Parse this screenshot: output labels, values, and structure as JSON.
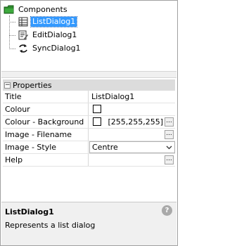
{
  "tree": {
    "root": {
      "label": "Components",
      "expanded": true
    },
    "children": [
      {
        "label": "ListDialog1",
        "icon": "list-dialog-icon",
        "selected": true
      },
      {
        "label": "EditDialog1",
        "icon": "edit-dialog-icon",
        "selected": false
      },
      {
        "label": "SyncDialog1",
        "icon": "sync-dialog-icon",
        "selected": false
      }
    ]
  },
  "properties": {
    "category": "Properties",
    "rows": [
      {
        "name": "Title",
        "value": "ListDialog1"
      },
      {
        "name": "Colour",
        "value": ""
      },
      {
        "name": "Colour - Background",
        "value": "[255,255,255]"
      },
      {
        "name": "Image - Filename",
        "value": ""
      },
      {
        "name": "Image - Style",
        "value": "Centre"
      },
      {
        "name": "Help",
        "value": ""
      }
    ],
    "ellipsis_label": "..."
  },
  "help": {
    "title": "ListDialog1",
    "description": "Represents a list dialog",
    "help_glyph": "?"
  },
  "colors": {
    "selection": "#3399ff",
    "category_bg": "#dcdcdc",
    "panel_bg": "#f0f0f0"
  }
}
